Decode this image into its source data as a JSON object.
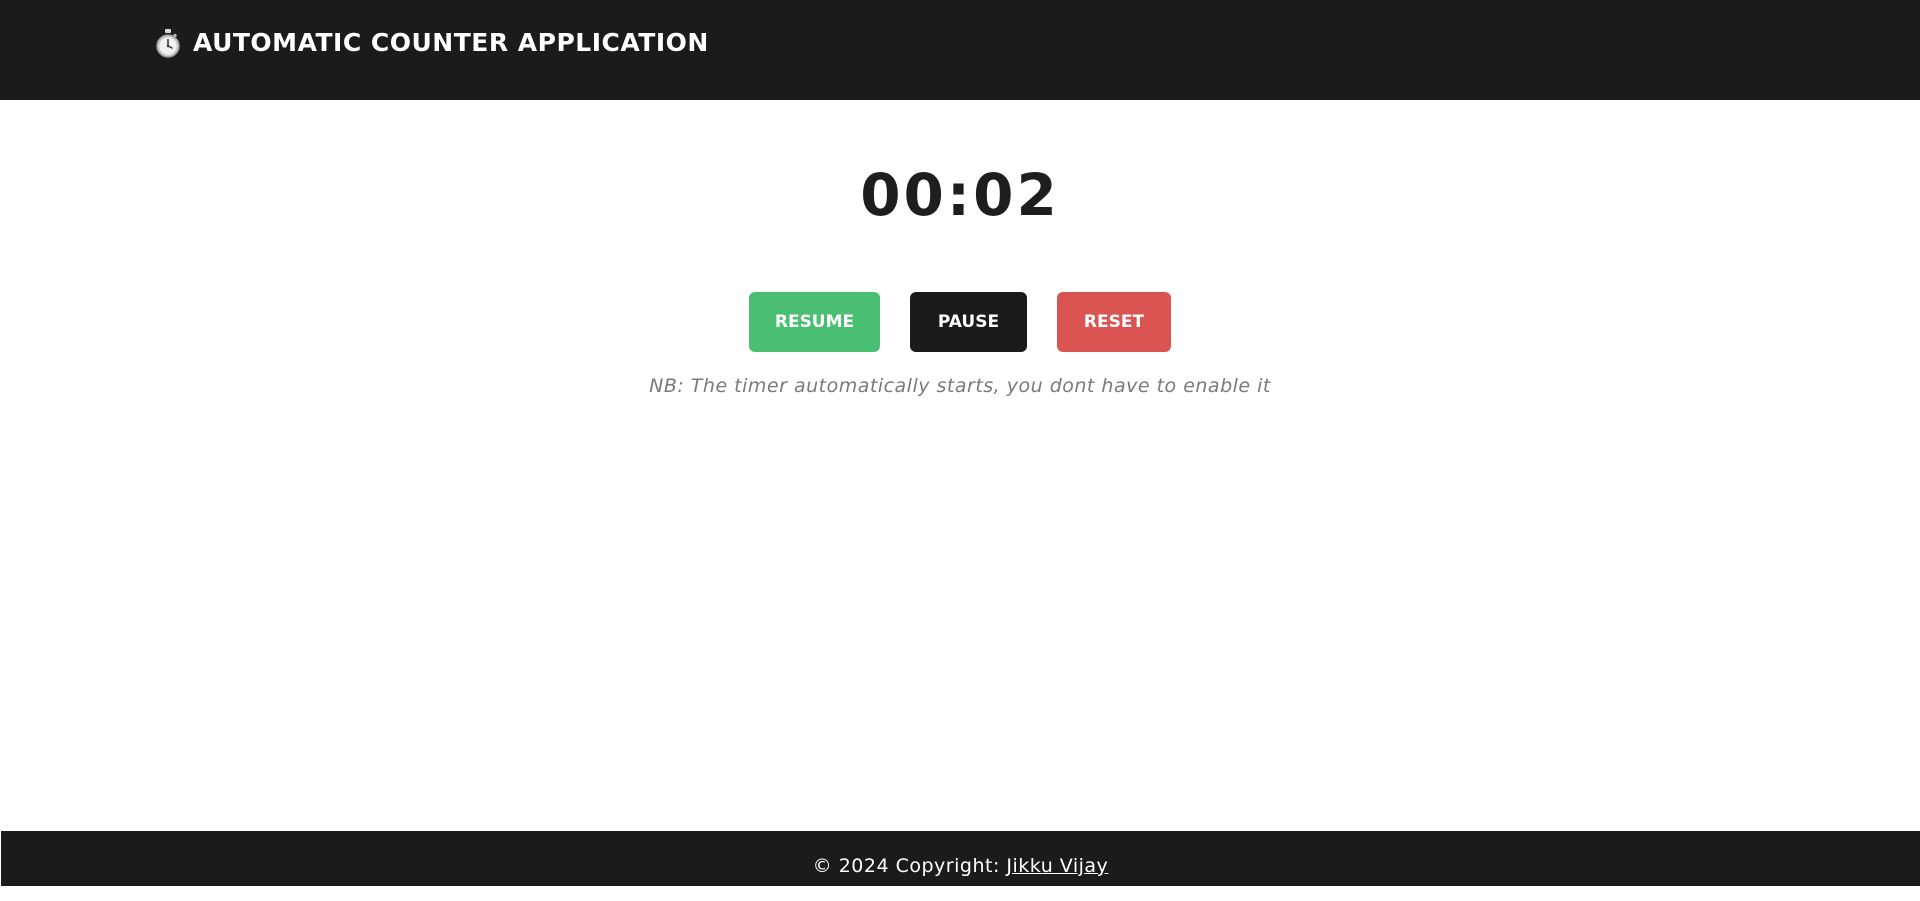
{
  "header": {
    "icon": "stopwatch-icon",
    "title": "AUTOMATIC COUNTER APPLICATION"
  },
  "timer": {
    "display": "00:02"
  },
  "controls": {
    "resume_label": "RESUME",
    "pause_label": "PAUSE",
    "reset_label": "RESET"
  },
  "note": "NB: The timer automatically starts, you dont have to enable it",
  "footer": {
    "copyright_text": "© 2024 Copyright: ",
    "author_link": "Jikku Vijay"
  },
  "colors": {
    "navbar_bg": "#1b1b1b",
    "resume": "#4abf73",
    "pause": "#1b1b1b",
    "reset": "#da5552",
    "timer_text": "#1e1e1e",
    "note_text": "#7a7a7a"
  }
}
